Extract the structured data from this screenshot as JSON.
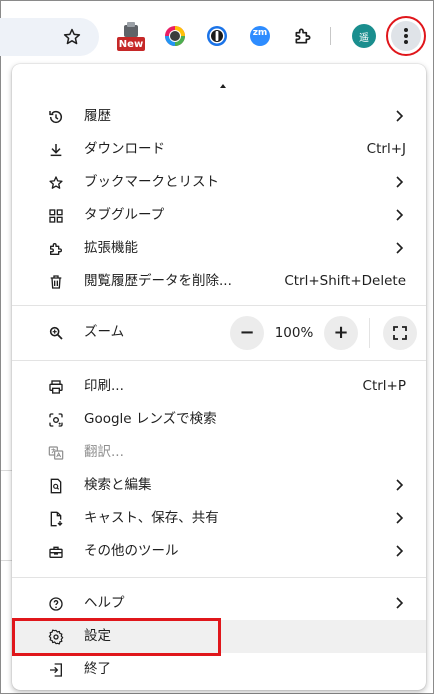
{
  "toolbar": {
    "star_icon": "star-icon",
    "extensions": [
      {
        "name": "new-extension",
        "badge": "New",
        "color": "#c62828"
      },
      {
        "name": "color-extension",
        "color": "#5f6368"
      },
      {
        "name": "onepassword-extension",
        "color": "#1a73e8"
      },
      {
        "name": "zoom-extension",
        "label": "zm",
        "color": "#2d8cff"
      },
      {
        "name": "extensions-puzzle",
        "color": "#1f1f1f"
      }
    ],
    "avatar_label": "遥",
    "avatar_color": "#1a8e8e"
  },
  "menu": {
    "history": {
      "label": "履歴"
    },
    "downloads": {
      "label": "ダウンロード",
      "shortcut": "Ctrl+J"
    },
    "bookmarks": {
      "label": "ブックマークとリスト"
    },
    "tab_groups": {
      "label": "タブグループ"
    },
    "extensions": {
      "label": "拡張機能"
    },
    "clear_data": {
      "label": "閲覧履歴データを削除...",
      "shortcut": "Ctrl+Shift+Delete"
    },
    "zoom": {
      "label": "ズーム",
      "minus": "−",
      "value": "100%",
      "plus": "+"
    },
    "print": {
      "label": "印刷...",
      "shortcut": "Ctrl+P"
    },
    "google_lens": {
      "label": "Google レンズで検索"
    },
    "translate": {
      "label": "翻訳..."
    },
    "find_edit": {
      "label": "検索と編集"
    },
    "cast_save_share": {
      "label": "キャスト、保存、共有"
    },
    "more_tools": {
      "label": "その他のツール"
    },
    "help": {
      "label": "ヘルプ"
    },
    "settings": {
      "label": "設定"
    },
    "exit": {
      "label": "終了"
    }
  },
  "colors": {
    "highlight": "#e0161b",
    "accent": "#1a73e8"
  }
}
